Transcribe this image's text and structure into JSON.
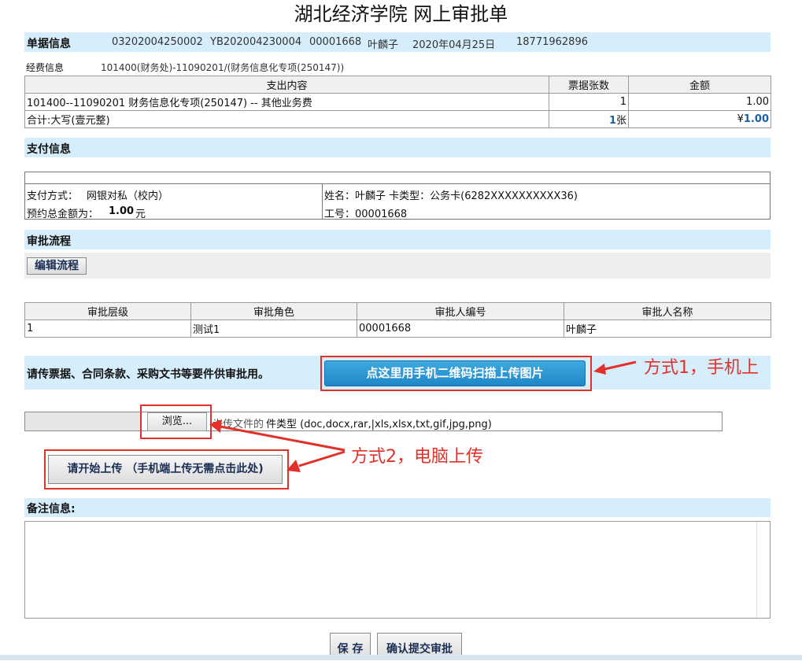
{
  "title": "湖北经济学院 网上审批单",
  "doc_info": {
    "label": "单据信息",
    "fields": [
      "03202004250002",
      "YB202004230004",
      "00001668",
      "叶麟子",
      "2020年04月25日",
      "18771962896"
    ]
  },
  "funding": {
    "label": "经费信息",
    "value": "101400(财务处)-11090201/(财务信息化专项(250147))"
  },
  "expense_table": {
    "headers": [
      "支出内容",
      "票据张数",
      "金额"
    ],
    "rows": [
      {
        "content": "101400--11090201 财务信息化专项(250147) -- 其他业务费",
        "count": "1",
        "amount": "1.00"
      }
    ],
    "total": {
      "label": "合计:大写(壹元整)",
      "count": "1",
      "count_unit": "张",
      "currency": "¥",
      "amount": "1.00"
    }
  },
  "payment": {
    "label": "支付信息",
    "method_label": "支付方式：",
    "method": "网银对私（校内）",
    "prepay_label": "预约总金额为：",
    "prepay_amount": "1.00",
    "prepay_unit": "元",
    "name_line": "姓名：叶麟子 卡类型：公务卡(6282XXXXXXXXXX36)",
    "staff_line": "工号：00001668"
  },
  "approval": {
    "label": "审批流程",
    "edit_button": "编辑流程",
    "headers": [
      "审批层级",
      "审批角色",
      "审批人编号",
      "审批人名称"
    ],
    "rows": [
      {
        "level": "1",
        "role": "测试1",
        "id": "00001668",
        "name": "叶麟子"
      }
    ]
  },
  "upload": {
    "prompt": "请传票据、合同条款、采购文书等要件供审批用。",
    "qr_button": "点这里用手机二维码扫描上传图片",
    "browse_button": "浏览...",
    "file_types": "件类型 (doc,docx,rar,|xls,xlsx,txt,gif,jpg,png)",
    "file_types_prefix": "许传文件的",
    "start_button": "请开始上传 （手机端上传无需点击此处)"
  },
  "annotations": {
    "method1": "方式1，手机上",
    "method2": "方式2，电脑上传"
  },
  "remarks": {
    "label": "备注信息:",
    "value": ""
  },
  "footer": {
    "save_button": "保 存",
    "submit_button": "确认提交审批"
  },
  "colors": {
    "band": "#d6eefb",
    "annotation_red": "#e2312a",
    "qr_button": "#2a96d4",
    "amount_blue": "#1a5fa8"
  }
}
